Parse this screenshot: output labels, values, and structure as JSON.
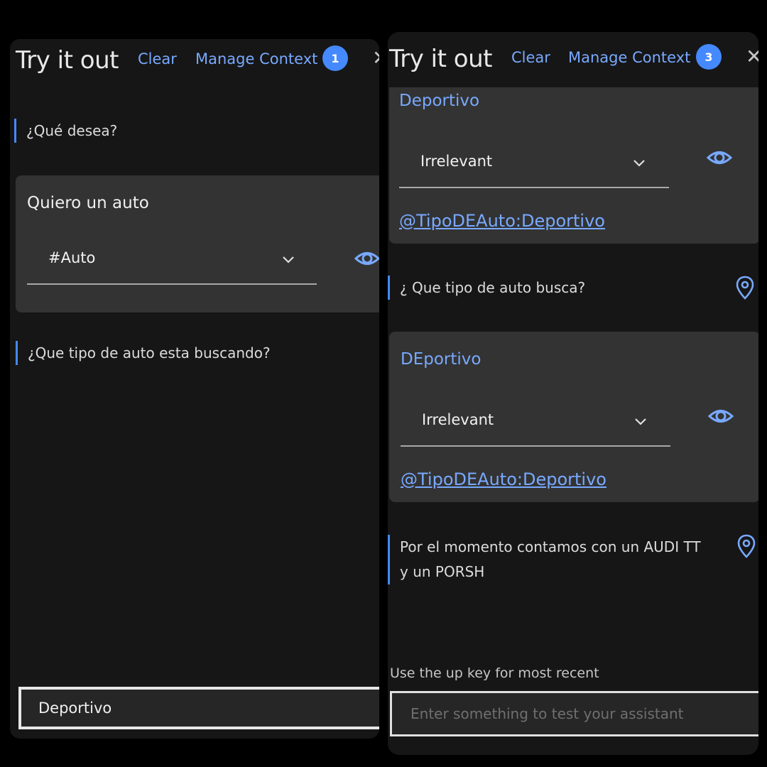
{
  "left_panel": {
    "header": {
      "title": "Try it out",
      "clear": "Clear",
      "manage_context": "Manage Context",
      "badge": "1"
    },
    "messages": {
      "bot_1": "¿Qué desea?",
      "user_card": {
        "text": "Quiero un auto",
        "intent": "#Auto"
      },
      "bot_2": "¿Que tipo de auto esta buscando?"
    },
    "input": {
      "value": "Deportivo"
    }
  },
  "right_panel": {
    "header": {
      "title": "Try it out",
      "clear": "Clear",
      "manage_context": "Manage Context",
      "badge": "3"
    },
    "card_1": {
      "text": "Deportivo",
      "intent": "Irrelevant",
      "entity": "@TipoDEAuto:Deportivo"
    },
    "bot_1": "¿ Que tipo de auto busca?",
    "card_2": {
      "text": "DEportivo",
      "intent": "Irrelevant",
      "entity": "@TipoDEAuto:Deportivo"
    },
    "bot_2": "Por el momento contamos con un AUDI TT y un PORSH",
    "hint": "Use the up key for most recent",
    "input": {
      "placeholder": "Enter something to test your assistant"
    }
  },
  "colors": {
    "accent": "#78a9ff",
    "badge": "#4589ff",
    "background": "#161616",
    "card": "#333333"
  },
  "icons": [
    "eye-icon",
    "chevron-down-icon",
    "location-pin-icon",
    "close-icon"
  ]
}
